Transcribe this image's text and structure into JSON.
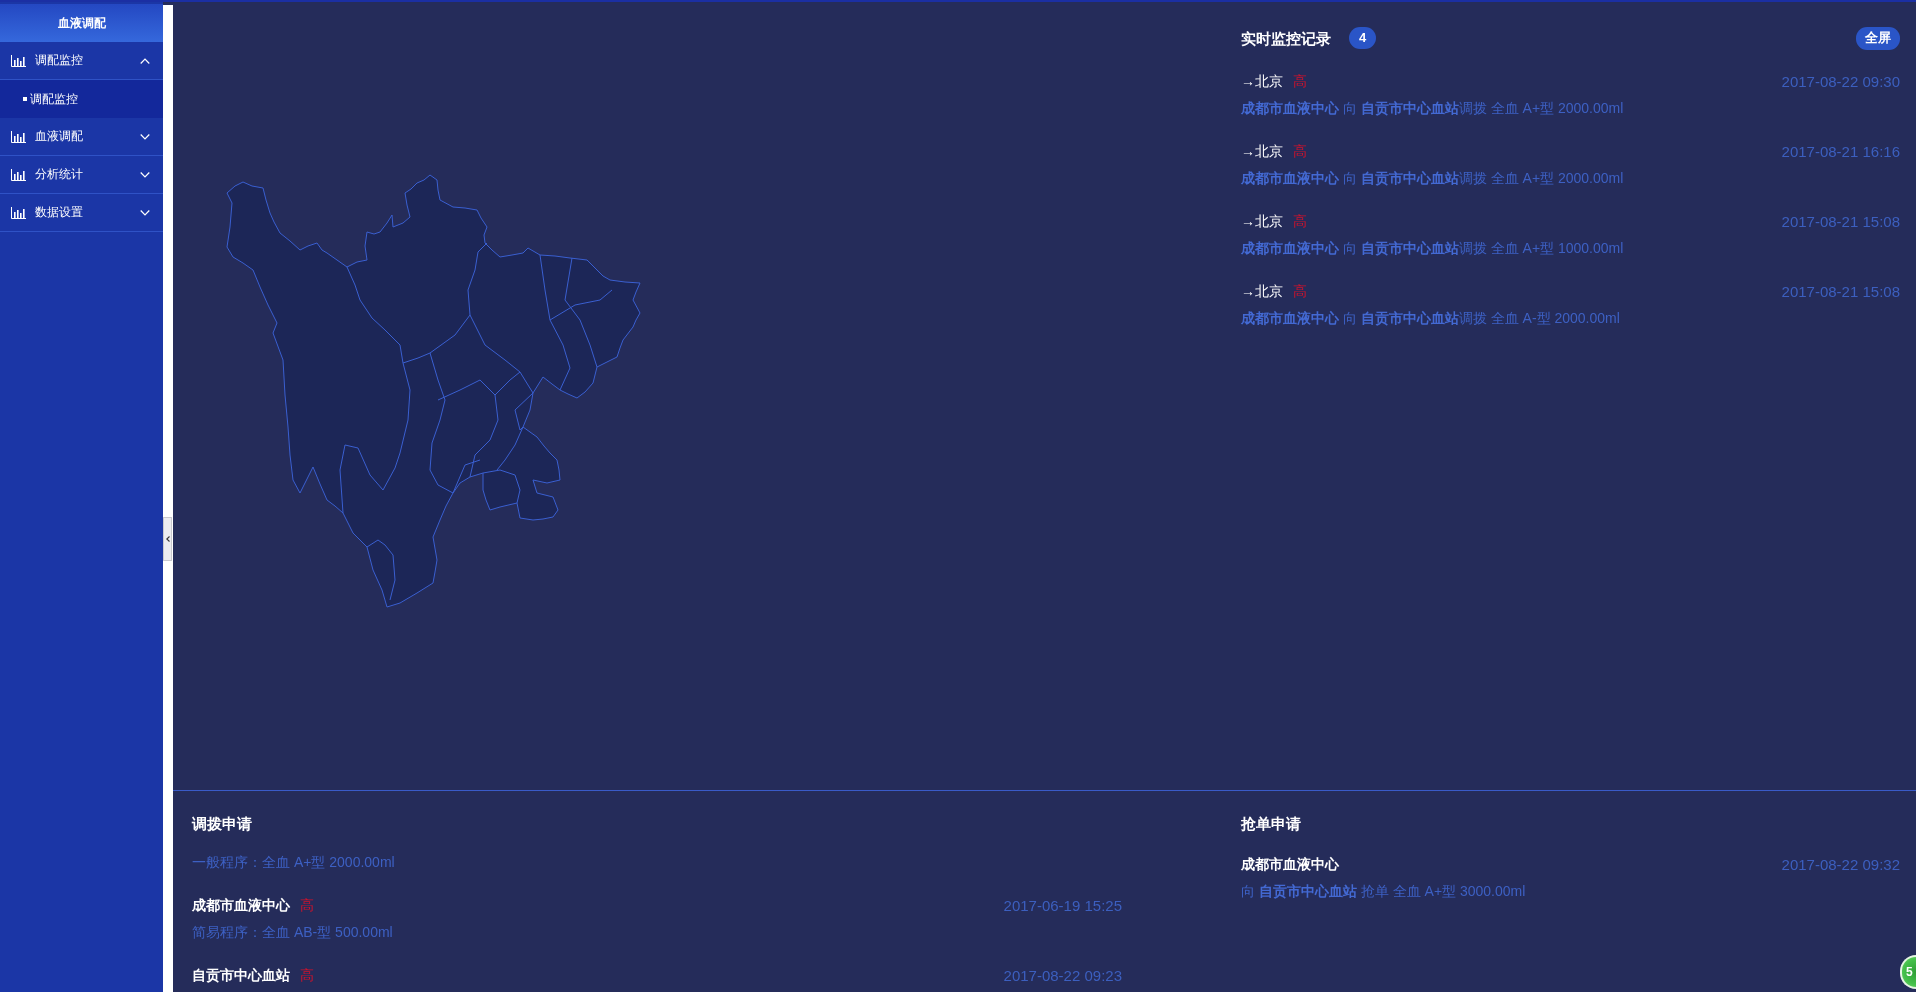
{
  "sidebar": {
    "title": "血液调配",
    "menu": [
      {
        "label": "调配监控",
        "expanded": true,
        "children": [
          {
            "label": "调配监控",
            "selected": true
          }
        ]
      },
      {
        "label": "血液调配",
        "expanded": false
      },
      {
        "label": "分析统计",
        "expanded": false
      },
      {
        "label": "数据设置",
        "expanded": false
      }
    ]
  },
  "monitor": {
    "title": "实时监控记录",
    "count": "4",
    "fullscreen_button": "全屏",
    "records": [
      {
        "route": "→北京",
        "priority": "高",
        "time": "2017-08-22 09:30",
        "detail": "**成都市血液中心** 向 **自贡市中心血站**调拨 全血 A+型 2000.00ml"
      },
      {
        "route": "→北京",
        "priority": "高",
        "time": "2017-08-21 16:16",
        "detail": "**成都市血液中心** 向 **自贡市中心血站**调拨 全血 A+型 2000.00ml"
      },
      {
        "route": "→北京",
        "priority": "高",
        "time": "2017-08-21 15:08",
        "detail": "**成都市血液中心** 向 **自贡市中心血站**调拨 全血 A+型 1000.00ml"
      },
      {
        "route": "→北京",
        "priority": "高",
        "time": "2017-08-21 15:08",
        "detail": "**成都市血液中心** 向 **自贡市中心血站**调拨 全血 A-型 2000.00ml"
      }
    ]
  },
  "transfer_requests": {
    "title": "调拨申请",
    "items": [
      {
        "detail": "一般程序：全血 A+型 2000.00ml"
      },
      {
        "station": "成都市血液中心",
        "priority": "高",
        "time": "2017-06-19 15:25",
        "detail": "简易程序：全血 AB-型 500.00ml"
      },
      {
        "station": "自贡市中心血站",
        "priority": "高",
        "time": "2017-08-22 09:23"
      }
    ]
  },
  "grab_requests": {
    "title": "抢单申请",
    "items": [
      {
        "station": "成都市血液中心",
        "time": "2017-08-22 09:32",
        "detail": "向 **自贡市中心血站** 抢单 全血 A+型 3000.00ml"
      }
    ]
  },
  "floating_ball": {
    "text": "5"
  }
}
